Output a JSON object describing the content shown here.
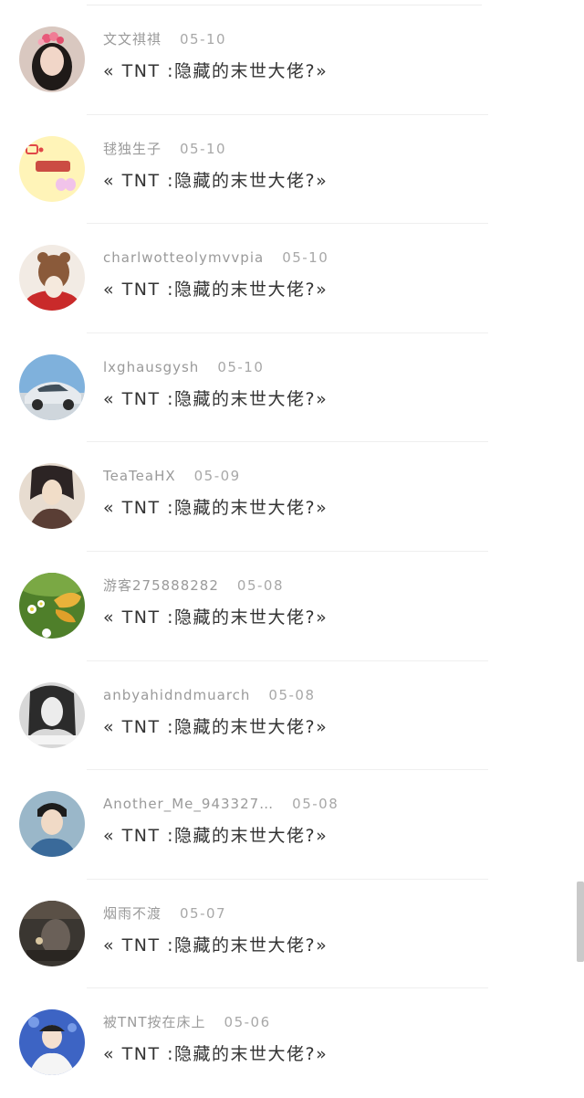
{
  "comments": [
    {
      "user": "文文祺祺",
      "date": "05-10",
      "title": "« TNT :隐藏的末世大佬?»",
      "avatar": "girl-with-flower-crown-avatar",
      "bg": "#d9c8c0"
    },
    {
      "user": "毬独生子",
      "date": "05-10",
      "title": "« TNT :隐藏的末世大佬?»",
      "avatar": "cartoon-text-avatar",
      "bg": "#fff4b8"
    },
    {
      "user": "charlwotteolymvvpia",
      "date": "05-10",
      "title": "« TNT :隐藏的末世大佬?»",
      "avatar": "teddy-bear-avatar",
      "bg": "#f2ebe4"
    },
    {
      "user": "lxghausgysh",
      "date": "05-10",
      "title": "« TNT :隐藏的末世大佬?»",
      "avatar": "silver-car-avatar",
      "bg": "#7fb1dc"
    },
    {
      "user": "TeaTeaHX",
      "date": "05-09",
      "title": "« TNT :隐藏的末世大佬?»",
      "avatar": "anime-character-avatar",
      "bg": "#e7dcd0"
    },
    {
      "user": "游客275888282",
      "date": "05-08",
      "title": "« TNT :隐藏的末世大佬?»",
      "avatar": "butterfly-flowers-avatar",
      "bg": "#4f7f2a"
    },
    {
      "user": "anbyahidndmuarch",
      "date": "05-08",
      "title": "« TNT :隐藏的末世大佬?»",
      "avatar": "black-white-portrait-avatar",
      "bg": "#d8d8d8"
    },
    {
      "user": "Another_Me_943327…",
      "date": "05-08",
      "title": "« TNT :隐藏的末世大佬?»",
      "avatar": "boy-portrait-avatar",
      "bg": "#9ab7c9"
    },
    {
      "user": "烟雨不渡",
      "date": "05-07",
      "title": "« TNT :隐藏的末世大佬?»",
      "avatar": "dark-scene-avatar",
      "bg": "#3a3631"
    },
    {
      "user": "被TNT按在床上",
      "date": "05-06",
      "title": "« TNT :隐藏的末世大佬?»",
      "avatar": "stage-singer-avatar",
      "bg": "#3d64c4"
    }
  ]
}
